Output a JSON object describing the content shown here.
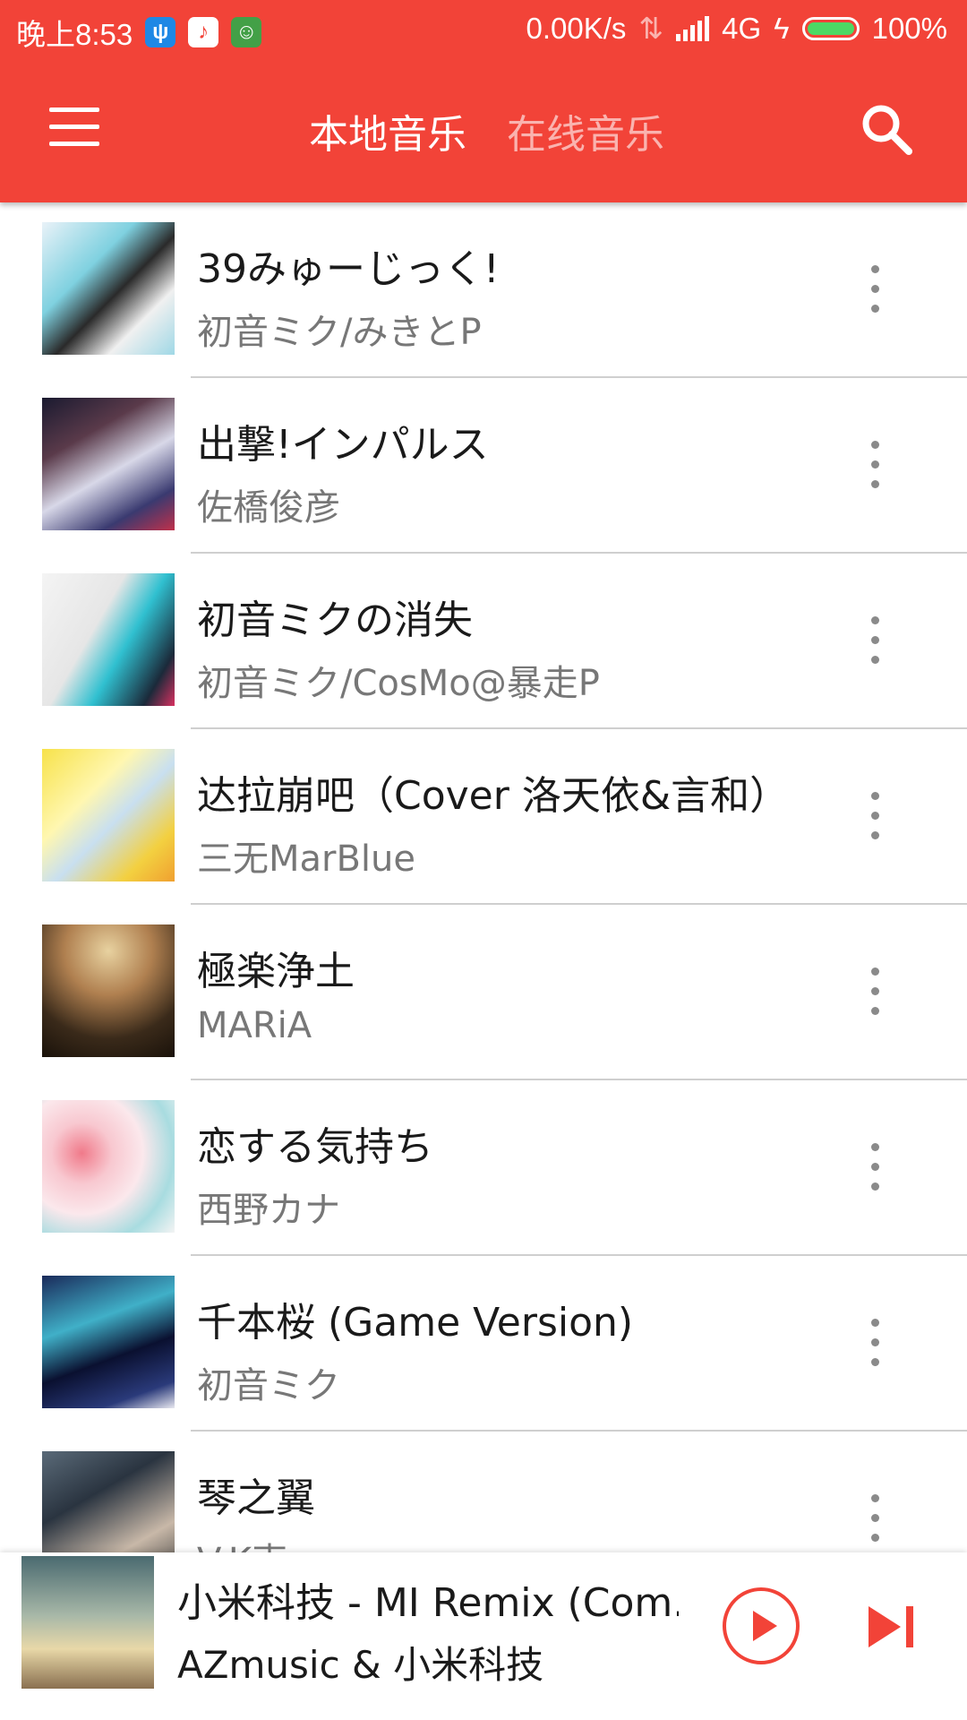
{
  "status_bar": {
    "time": "晚上8:53",
    "network_speed": "0.00K/s",
    "network_type": "4G",
    "battery": "100%"
  },
  "app_bar": {
    "tabs": [
      {
        "label": "本地音乐",
        "active": true
      },
      {
        "label": "在线音乐",
        "active": false
      }
    ],
    "menu_icon": "hamburger-icon",
    "search_icon": "search-icon"
  },
  "songs": [
    {
      "title": "39みゅーじっく!",
      "artist": "初音ミク/みきとP"
    },
    {
      "title": "出撃!インパルス",
      "artist": "佐橋俊彦"
    },
    {
      "title": "初音ミクの消失",
      "artist": "初音ミク/CosMo@暴走P"
    },
    {
      "title": "达拉崩吧（Cover 洛天依&言和）",
      "artist": "三无MarBlue"
    },
    {
      "title": "極楽浄土",
      "artist": "MARiA"
    },
    {
      "title": "恋する気持ち",
      "artist": "西野カナ"
    },
    {
      "title": "千本桜 (Game Version)",
      "artist": "初音ミク"
    },
    {
      "title": "琴之翼",
      "artist": "V.K克"
    }
  ],
  "now_playing": {
    "title": "小米科技 - MI Remix (Com...",
    "artist": "AZmusic & 小米科技"
  },
  "colors": {
    "accent": "#f24338",
    "divider": "#cfcfcf",
    "secondary_text": "#777777"
  }
}
